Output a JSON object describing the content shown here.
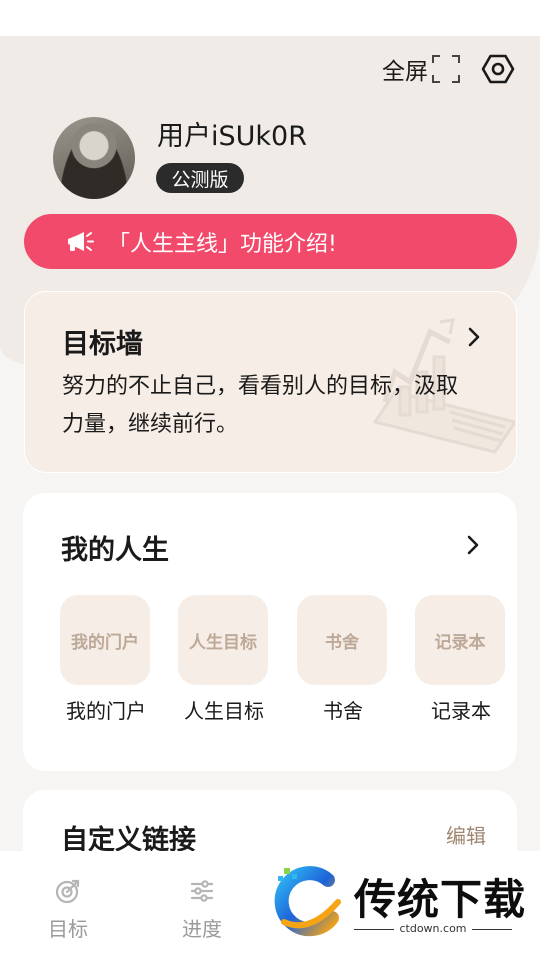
{
  "header": {
    "fullscreen_label": "全屏",
    "fullscreen_icon": "fullscreen-icon",
    "settings_icon": "settings-hexagon-icon"
  },
  "profile": {
    "username": "用户iSUk0R",
    "badge": "公测版"
  },
  "banner": {
    "icon": "megaphone-icon",
    "text": "「人生主线」功能介绍!"
  },
  "goal_wall": {
    "title": "目标墙",
    "description": "努力的不止自己，看看别人的目标，汲取力量，继续前行。"
  },
  "my_life": {
    "title": "我的人生",
    "items": [
      {
        "tile": "我的门户",
        "label": "我的门户"
      },
      {
        "tile": "人生目标",
        "label": "人生目标"
      },
      {
        "tile": "书舍",
        "label": "书舍"
      },
      {
        "tile": "记录本",
        "label": "记录本"
      }
    ]
  },
  "custom_links": {
    "title": "自定义链接",
    "edit": "编辑"
  },
  "bottom_nav": {
    "items": [
      {
        "label": "目标",
        "icon": "target-icon"
      },
      {
        "label": "进度",
        "icon": "sliders-icon"
      }
    ]
  },
  "watermark": {
    "text": "传统下载",
    "url": "ctdown.com"
  },
  "colors": {
    "accent": "#f24a6b",
    "tile_bg": "#f6ede6",
    "tile_text": "#bda998",
    "edit_text": "#a08670"
  }
}
